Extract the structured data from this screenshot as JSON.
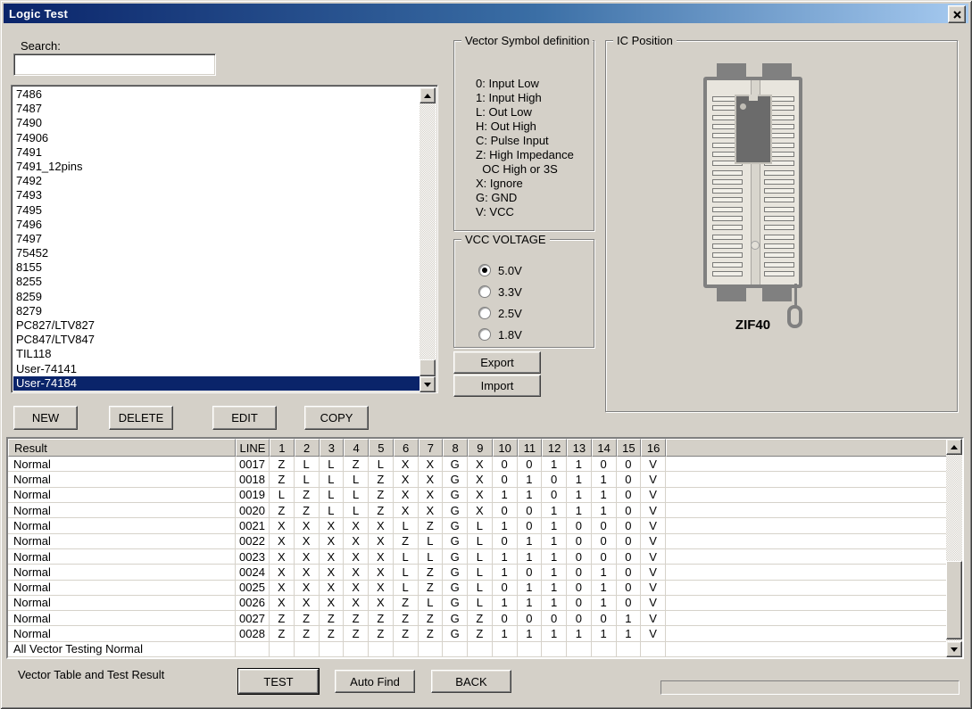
{
  "window": {
    "title": "Logic Test"
  },
  "search": {
    "label": "Search:",
    "value": ""
  },
  "ic_list": {
    "items": [
      "7486",
      "7487",
      "7490",
      "74906",
      "7491",
      "7491_12pins",
      "7492",
      "7493",
      "7495",
      "7496",
      "7497",
      "75452",
      "8155",
      "8255",
      "8259",
      "8279",
      "PC827/LTV827",
      "PC847/LTV847",
      "TIL118",
      "User-74141",
      "User-74184"
    ],
    "selected": "User-74184"
  },
  "list_buttons": {
    "new": "NEW",
    "delete": "DELETE",
    "edit": "EDIT",
    "copy": "COPY"
  },
  "vector_symbols": {
    "title": "Vector Symbol definition",
    "lines": [
      "0: Input Low",
      "1: Input High",
      "L: Out Low",
      "H: Out High",
      "C: Pulse Input",
      "Z: High Impedance",
      "  OC High or 3S",
      "X: Ignore",
      "G: GND",
      "V: VCC"
    ]
  },
  "vcc": {
    "title": "VCC VOLTAGE",
    "options": [
      {
        "label": "5.0V",
        "selected": true
      },
      {
        "label": "3.3V",
        "selected": false
      },
      {
        "label": "2.5V",
        "selected": false
      },
      {
        "label": "1.8V",
        "selected": false
      }
    ]
  },
  "io_buttons": {
    "export": "Export",
    "import": "Import"
  },
  "ic_position": {
    "title": "IC Position",
    "socket_label": "ZIF40"
  },
  "result_table": {
    "columns": [
      "Result",
      "LINE",
      "1",
      "2",
      "3",
      "4",
      "5",
      "6",
      "7",
      "8",
      "9",
      "10",
      "11",
      "12",
      "13",
      "14",
      "15",
      "16"
    ],
    "rows": [
      {
        "result": "Normal",
        "line": "0017",
        "values": [
          "Z",
          "L",
          "L",
          "Z",
          "L",
          "X",
          "X",
          "G",
          "X",
          "0",
          "0",
          "1",
          "1",
          "0",
          "0",
          "V"
        ]
      },
      {
        "result": "Normal",
        "line": "0018",
        "values": [
          "Z",
          "L",
          "L",
          "L",
          "Z",
          "X",
          "X",
          "G",
          "X",
          "0",
          "1",
          "0",
          "1",
          "1",
          "0",
          "V"
        ]
      },
      {
        "result": "Normal",
        "line": "0019",
        "values": [
          "L",
          "Z",
          "L",
          "L",
          "Z",
          "X",
          "X",
          "G",
          "X",
          "1",
          "1",
          "0",
          "1",
          "1",
          "0",
          "V"
        ]
      },
      {
        "result": "Normal",
        "line": "0020",
        "values": [
          "Z",
          "Z",
          "L",
          "L",
          "Z",
          "X",
          "X",
          "G",
          "X",
          "0",
          "0",
          "1",
          "1",
          "1",
          "0",
          "V"
        ]
      },
      {
        "result": "Normal",
        "line": "0021",
        "values": [
          "X",
          "X",
          "X",
          "X",
          "X",
          "L",
          "Z",
          "G",
          "L",
          "1",
          "0",
          "1",
          "0",
          "0",
          "0",
          "V"
        ]
      },
      {
        "result": "Normal",
        "line": "0022",
        "values": [
          "X",
          "X",
          "X",
          "X",
          "X",
          "Z",
          "L",
          "G",
          "L",
          "0",
          "1",
          "1",
          "0",
          "0",
          "0",
          "V"
        ]
      },
      {
        "result": "Normal",
        "line": "0023",
        "values": [
          "X",
          "X",
          "X",
          "X",
          "X",
          "L",
          "L",
          "G",
          "L",
          "1",
          "1",
          "1",
          "0",
          "0",
          "0",
          "V"
        ]
      },
      {
        "result": "Normal",
        "line": "0024",
        "values": [
          "X",
          "X",
          "X",
          "X",
          "X",
          "L",
          "Z",
          "G",
          "L",
          "1",
          "0",
          "1",
          "0",
          "1",
          "0",
          "V"
        ]
      },
      {
        "result": "Normal",
        "line": "0025",
        "values": [
          "X",
          "X",
          "X",
          "X",
          "X",
          "L",
          "Z",
          "G",
          "L",
          "0",
          "1",
          "1",
          "0",
          "1",
          "0",
          "V"
        ]
      },
      {
        "result": "Normal",
        "line": "0026",
        "values": [
          "X",
          "X",
          "X",
          "X",
          "X",
          "Z",
          "L",
          "G",
          "L",
          "1",
          "1",
          "1",
          "0",
          "1",
          "0",
          "V"
        ]
      },
      {
        "result": "Normal",
        "line": "0027",
        "values": [
          "Z",
          "Z",
          "Z",
          "Z",
          "Z",
          "Z",
          "Z",
          "G",
          "Z",
          "0",
          "0",
          "0",
          "0",
          "0",
          "1",
          "V"
        ]
      },
      {
        "result": "Normal",
        "line": "0028",
        "values": [
          "Z",
          "Z",
          "Z",
          "Z",
          "Z",
          "Z",
          "Z",
          "G",
          "Z",
          "1",
          "1",
          "1",
          "1",
          "1",
          "1",
          "V"
        ]
      }
    ],
    "footer_row": "All Vector Testing Normal"
  },
  "footer": {
    "status_label": "Vector Table and Test Result",
    "test": "TEST",
    "auto_find": "Auto Find",
    "back": "BACK"
  },
  "colors": {
    "window_bg": "#d4d0c8",
    "titlebar_start": "#0a246a",
    "titlebar_end": "#a6caf0",
    "selection": "#0a246a"
  }
}
